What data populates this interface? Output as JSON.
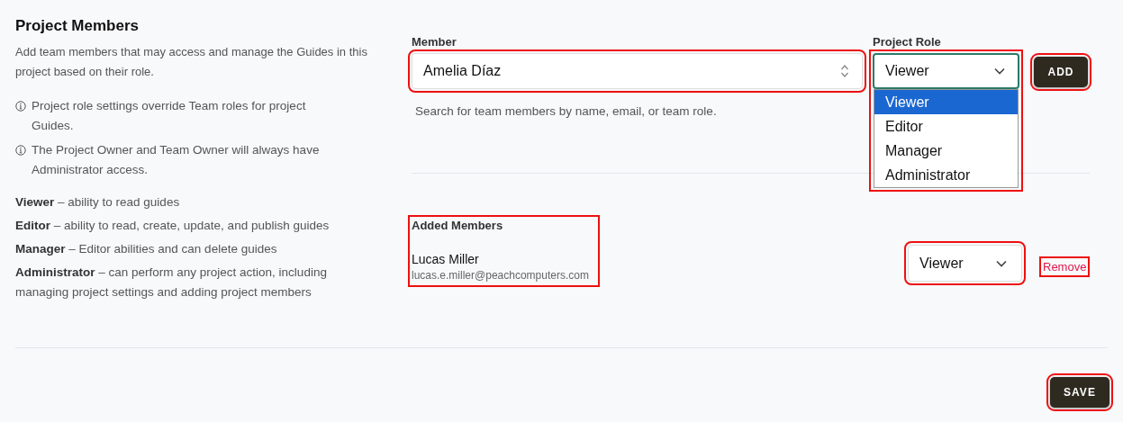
{
  "section": {
    "title": "Project Members",
    "description": "Add team members that may access and manage the Guides in this project based on their role.",
    "notes": [
      "Project role settings override Team roles for project Guides.",
      "The Project Owner and Team Owner will always have Administrator access."
    ],
    "roles": [
      "**Viewer** – ability to read guides",
      "**Editor** – ability to read, create, update, and publish guides",
      "**Manager** – Editor abilities and can delete guides",
      "**Administrator** – can perform any project action, including managing project settings and adding project members"
    ]
  },
  "member_field": {
    "label": "Member",
    "value": "Amelia Díaz",
    "help": "Search for team members by name, email, or team role.",
    "highlighted": true
  },
  "role_field": {
    "label": "Project Role",
    "value": "Viewer",
    "highlighted": true,
    "expanded": true,
    "options": [
      {
        "label": "Viewer",
        "selected": true
      },
      {
        "label": "Editor",
        "selected": false
      },
      {
        "label": "Manager",
        "selected": false
      },
      {
        "label": "Administrator",
        "selected": false
      }
    ]
  },
  "add_button": {
    "label": "ADD",
    "highlighted": true
  },
  "added_members": {
    "title": "Added Members",
    "highlighted": true,
    "members": [
      {
        "name": "Lucas Miller",
        "email": "lucas.e.miller@peachcomputers.com",
        "role": "Viewer",
        "role_highlighted": true,
        "remove_label": "Remove",
        "remove_highlighted": true
      }
    ]
  },
  "save_button": {
    "label": "SAVE",
    "highlighted": true
  }
}
